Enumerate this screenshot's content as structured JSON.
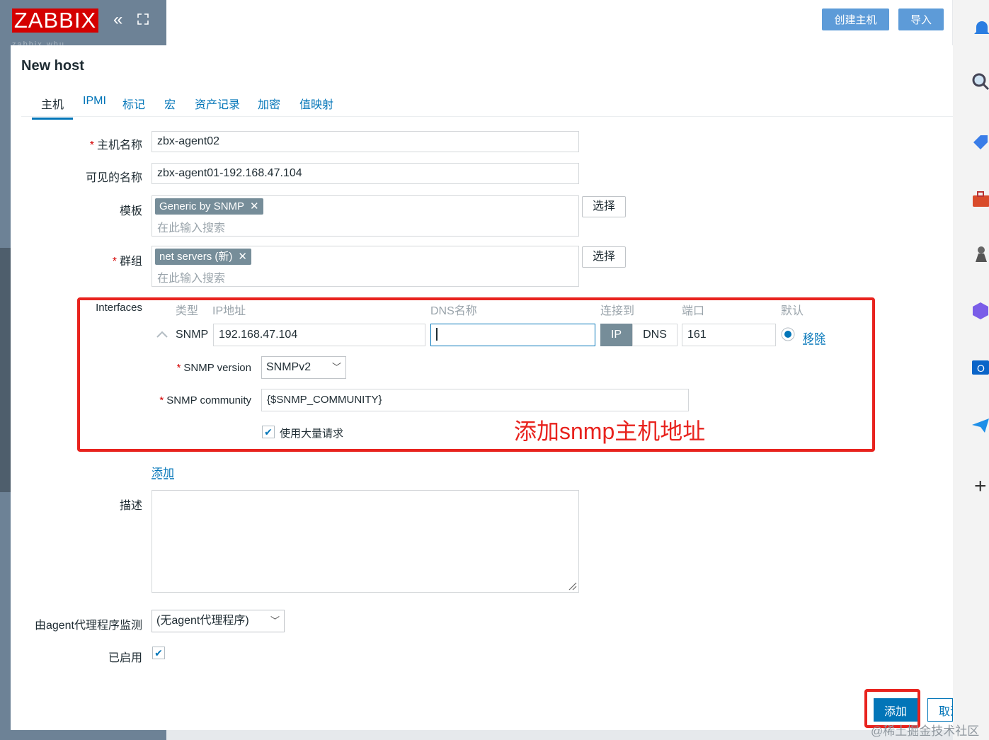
{
  "app": {
    "logo": "ZABBIX",
    "sub": "zabbix.whu"
  },
  "top": {
    "create_host": "创建主机",
    "import": "导入"
  },
  "dialog": {
    "title": "New host"
  },
  "tabs": [
    "主机",
    "IPMI",
    "标记",
    "宏",
    "资产记录",
    "加密",
    "值映射"
  ],
  "form": {
    "host_name_label": "主机名称",
    "host_name_value": "zbx-agent02",
    "visible_name_label": "可见的名称",
    "visible_name_value": "zbx-agent01-192.168.47.104",
    "templates_label": "模板",
    "template_chip": "Generic by SNMP",
    "groups_label": "群组",
    "group_chip": "net servers (新)",
    "search_placeholder": "在此输入搜索",
    "select_button": "选择",
    "interfaces_label": "Interfaces",
    "columns": {
      "type": "类型",
      "ip": "IP地址",
      "dns": "DNS名称",
      "connect": "连接到",
      "port": "端口",
      "default": "默认"
    },
    "interface": {
      "type": "SNMP",
      "ip": "192.168.47.104",
      "dns": "",
      "connect_ip": "IP",
      "connect_dns": "DNS",
      "port": "161",
      "remove": "移除",
      "snmp_version_label": "SNMP version",
      "snmp_version": "SNMPv2",
      "snmp_community_label": "SNMP community",
      "snmp_community": "{$SNMP_COMMUNITY}",
      "bulk_label": "使用大量请求"
    },
    "add_link": "添加",
    "description_label": "描述",
    "proxy_label": "由agent代理程序监测",
    "proxy_value": "(无agent代理程序)",
    "enabled_label": "已启用"
  },
  "annotation": "添加snmp主机地址",
  "buttons": {
    "add": "添加",
    "cancel": "取消"
  },
  "watermark": "@稀土掘金技术社区",
  "colors": {
    "accent": "#0275b8",
    "annotation": "#e8231e",
    "logo": "#d40000"
  }
}
